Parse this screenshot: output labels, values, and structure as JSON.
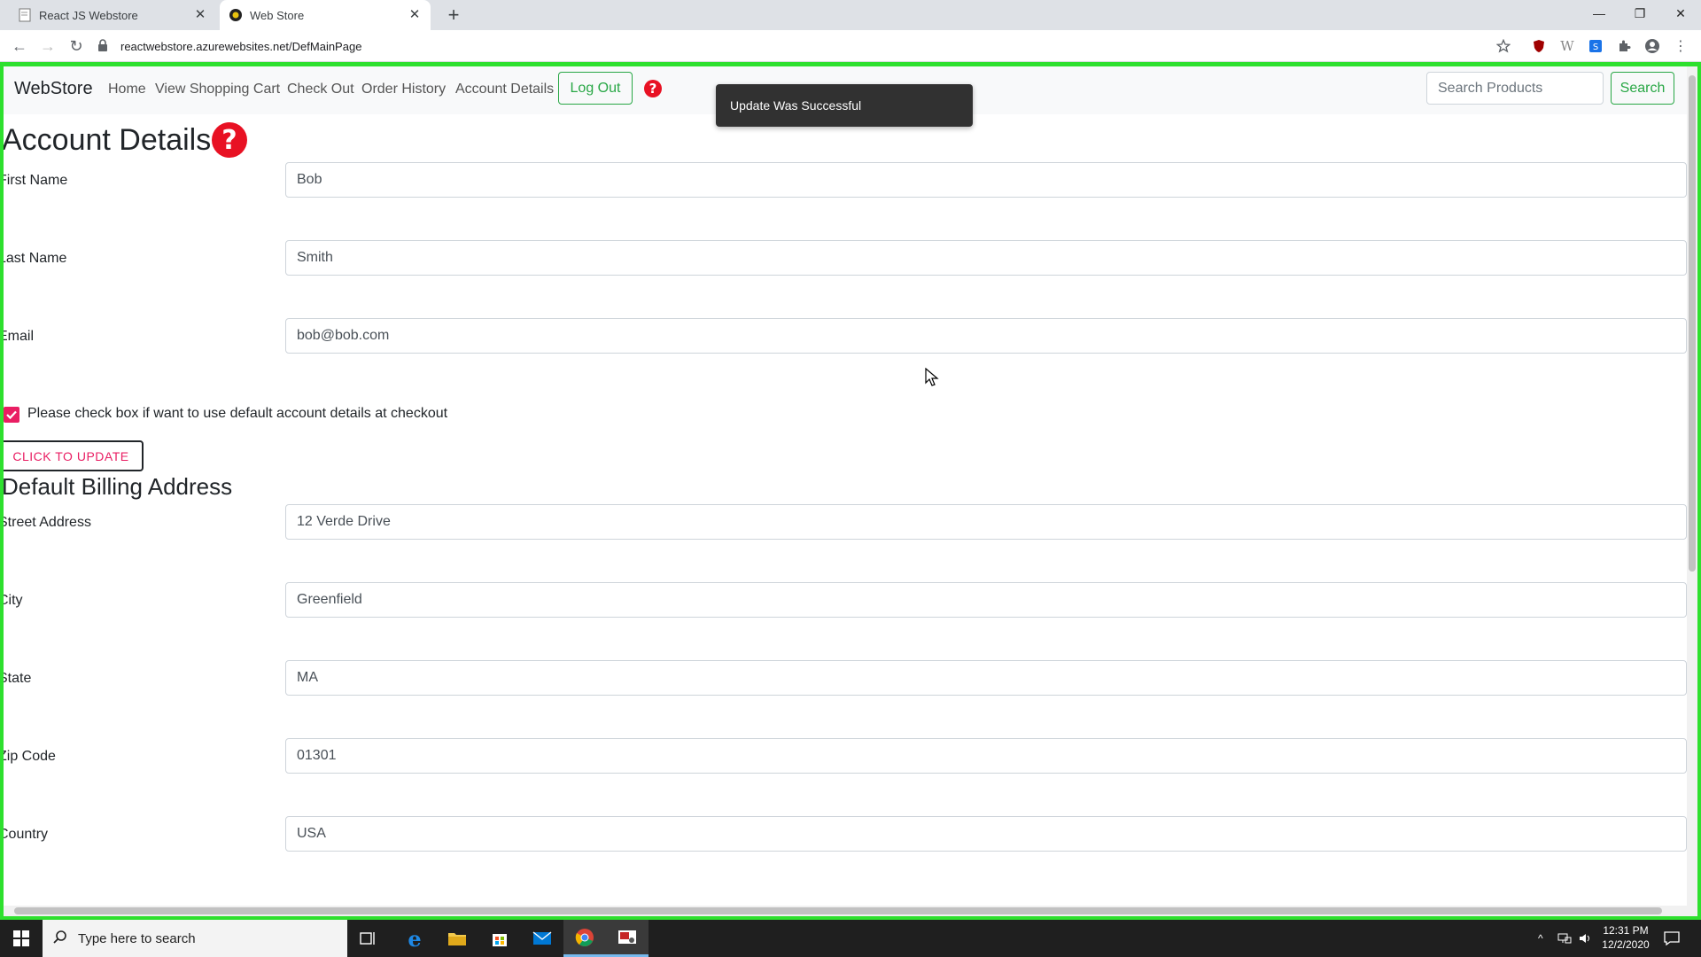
{
  "browser": {
    "tabs": [
      {
        "title": "React JS Webstore"
      },
      {
        "title": "Web Store"
      }
    ],
    "new_tab_icon": "plus-icon",
    "url": "reactwebstore.azurewebsites.net/DefMainPage",
    "window_controls": [
      "minimize-icon",
      "restore-icon",
      "close-icon"
    ]
  },
  "app": {
    "brand": "WebStore",
    "nav": [
      {
        "label": "Home"
      },
      {
        "label": "View Shopping Cart"
      },
      {
        "label": "Check Out"
      },
      {
        "label": "Order History"
      },
      {
        "label": "Account Details"
      }
    ],
    "logout_label": "Log Out",
    "search": {
      "placeholder": "Search Products",
      "value": "",
      "button_label": "Search"
    },
    "toast": "Update Was Successful",
    "accent_color": "#28a745",
    "help_color": "#e81123"
  },
  "account": {
    "title": "Account Details",
    "fields": [
      {
        "label": "First Name",
        "value": "Bob"
      },
      {
        "label": "Last Name",
        "value": "Smith"
      },
      {
        "label": "Email",
        "value": "bob@bob.com"
      }
    ],
    "checkbox": {
      "label": "Please check box if want to use default account details at checkout",
      "checked": true
    },
    "update_label": "CLICK TO UPDATE"
  },
  "billing": {
    "title": "Default Billing Address",
    "fields": [
      {
        "label": "Street Address",
        "value": "12 Verde Drive"
      },
      {
        "label": "City",
        "value": "Greenfield"
      },
      {
        "label": "State",
        "value": "MA"
      },
      {
        "label": "Zip Code",
        "value": "01301"
      },
      {
        "label": "Country",
        "value": "USA"
      }
    ]
  },
  "taskbar": {
    "search_placeholder": "Type here to search",
    "time": "12:31 PM",
    "date": "12/2/2020"
  }
}
